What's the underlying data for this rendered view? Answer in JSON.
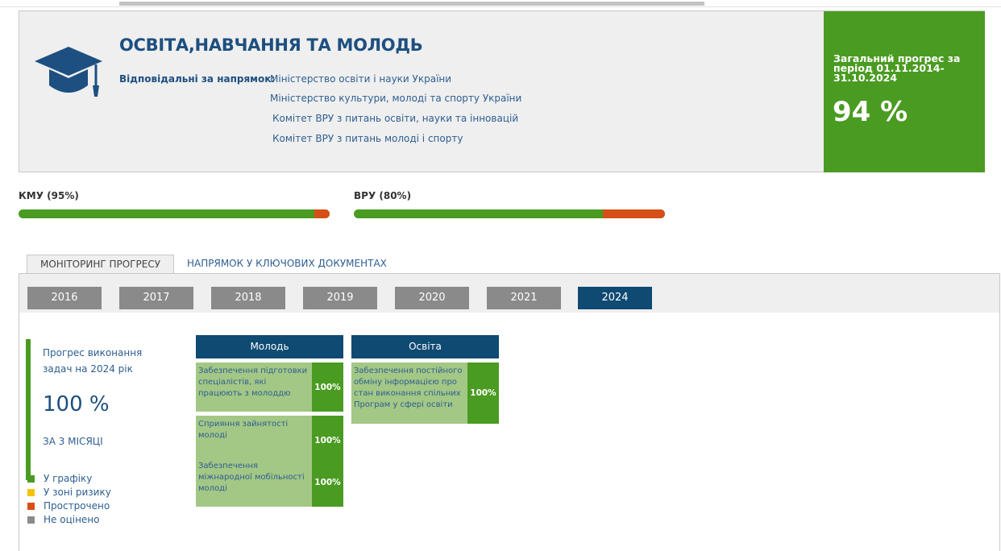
{
  "header": {
    "title": "ОСВІТА,НАВЧАННЯ ТА МОЛОДЬ",
    "responsible_label": "Відповідальні за напрямок:",
    "responsible": [
      "Міністерство освіти і науки України",
      "Міністерство культури, молоді та спорту України",
      "Комітет ВРУ з питань освіти, науки та інновацій",
      "Комітет ВРУ з питань молоді і спорту"
    ],
    "overall_label": "Загальний прогрес за період 01.11.2014-31.10.2024",
    "overall_value": "94 %",
    "icon": "graduation-cap-icon"
  },
  "bars": {
    "kmu": {
      "label": "КМУ (95%)",
      "on_track_fraction": 0.95
    },
    "vru": {
      "label": "ВРУ (80%)",
      "on_track_fraction": 0.8
    }
  },
  "tabs": [
    "МОНІТОРИНГ ПРОГРЕСУ",
    "НАПРЯМОК У КЛЮЧОВИХ ДОКУМЕНТАХ"
  ],
  "years": [
    "2016",
    "2017",
    "2018",
    "2019",
    "2020",
    "2021",
    "2024"
  ],
  "selected_year": "2024",
  "progress": {
    "label_line1": "Прогрес виконання",
    "label_line2": "задач на 2024 рік",
    "value": "100 %",
    "period": "ЗА 3 МІСЯЦІ"
  },
  "legend": [
    {
      "label": "У графіку",
      "color": "#4a9b21"
    },
    {
      "label": "У зоні ризику",
      "color": "#f5c400"
    },
    {
      "label": "Прострочено",
      "color": "#d64f17"
    },
    {
      "label": "Не оцінено",
      "color": "#8a8a8a"
    }
  ],
  "columns": [
    {
      "title": "Молодь",
      "tasks": [
        {
          "text": "Забезпечення підготовки спеціалістів, які працюють з молоддю",
          "pct": "100%"
        },
        {
          "text": "Сприяння зайнятості молоді",
          "pct": "100%"
        },
        {
          "text": "Забезпечення міжнародної мобільності молоді",
          "pct": "100%"
        }
      ]
    },
    {
      "title": "Освіта",
      "tasks": [
        {
          "text": "Забезпечення постійного обміну інформацією про стан виконання спільних Програм у сфері освіти",
          "pct": "100%"
        }
      ]
    }
  ],
  "colors": {
    "brand_blue": "#0f4a72",
    "on_track_green": "#4a9b21",
    "overdue_red": "#d64f17",
    "task_light_green": "#a3c785"
  }
}
